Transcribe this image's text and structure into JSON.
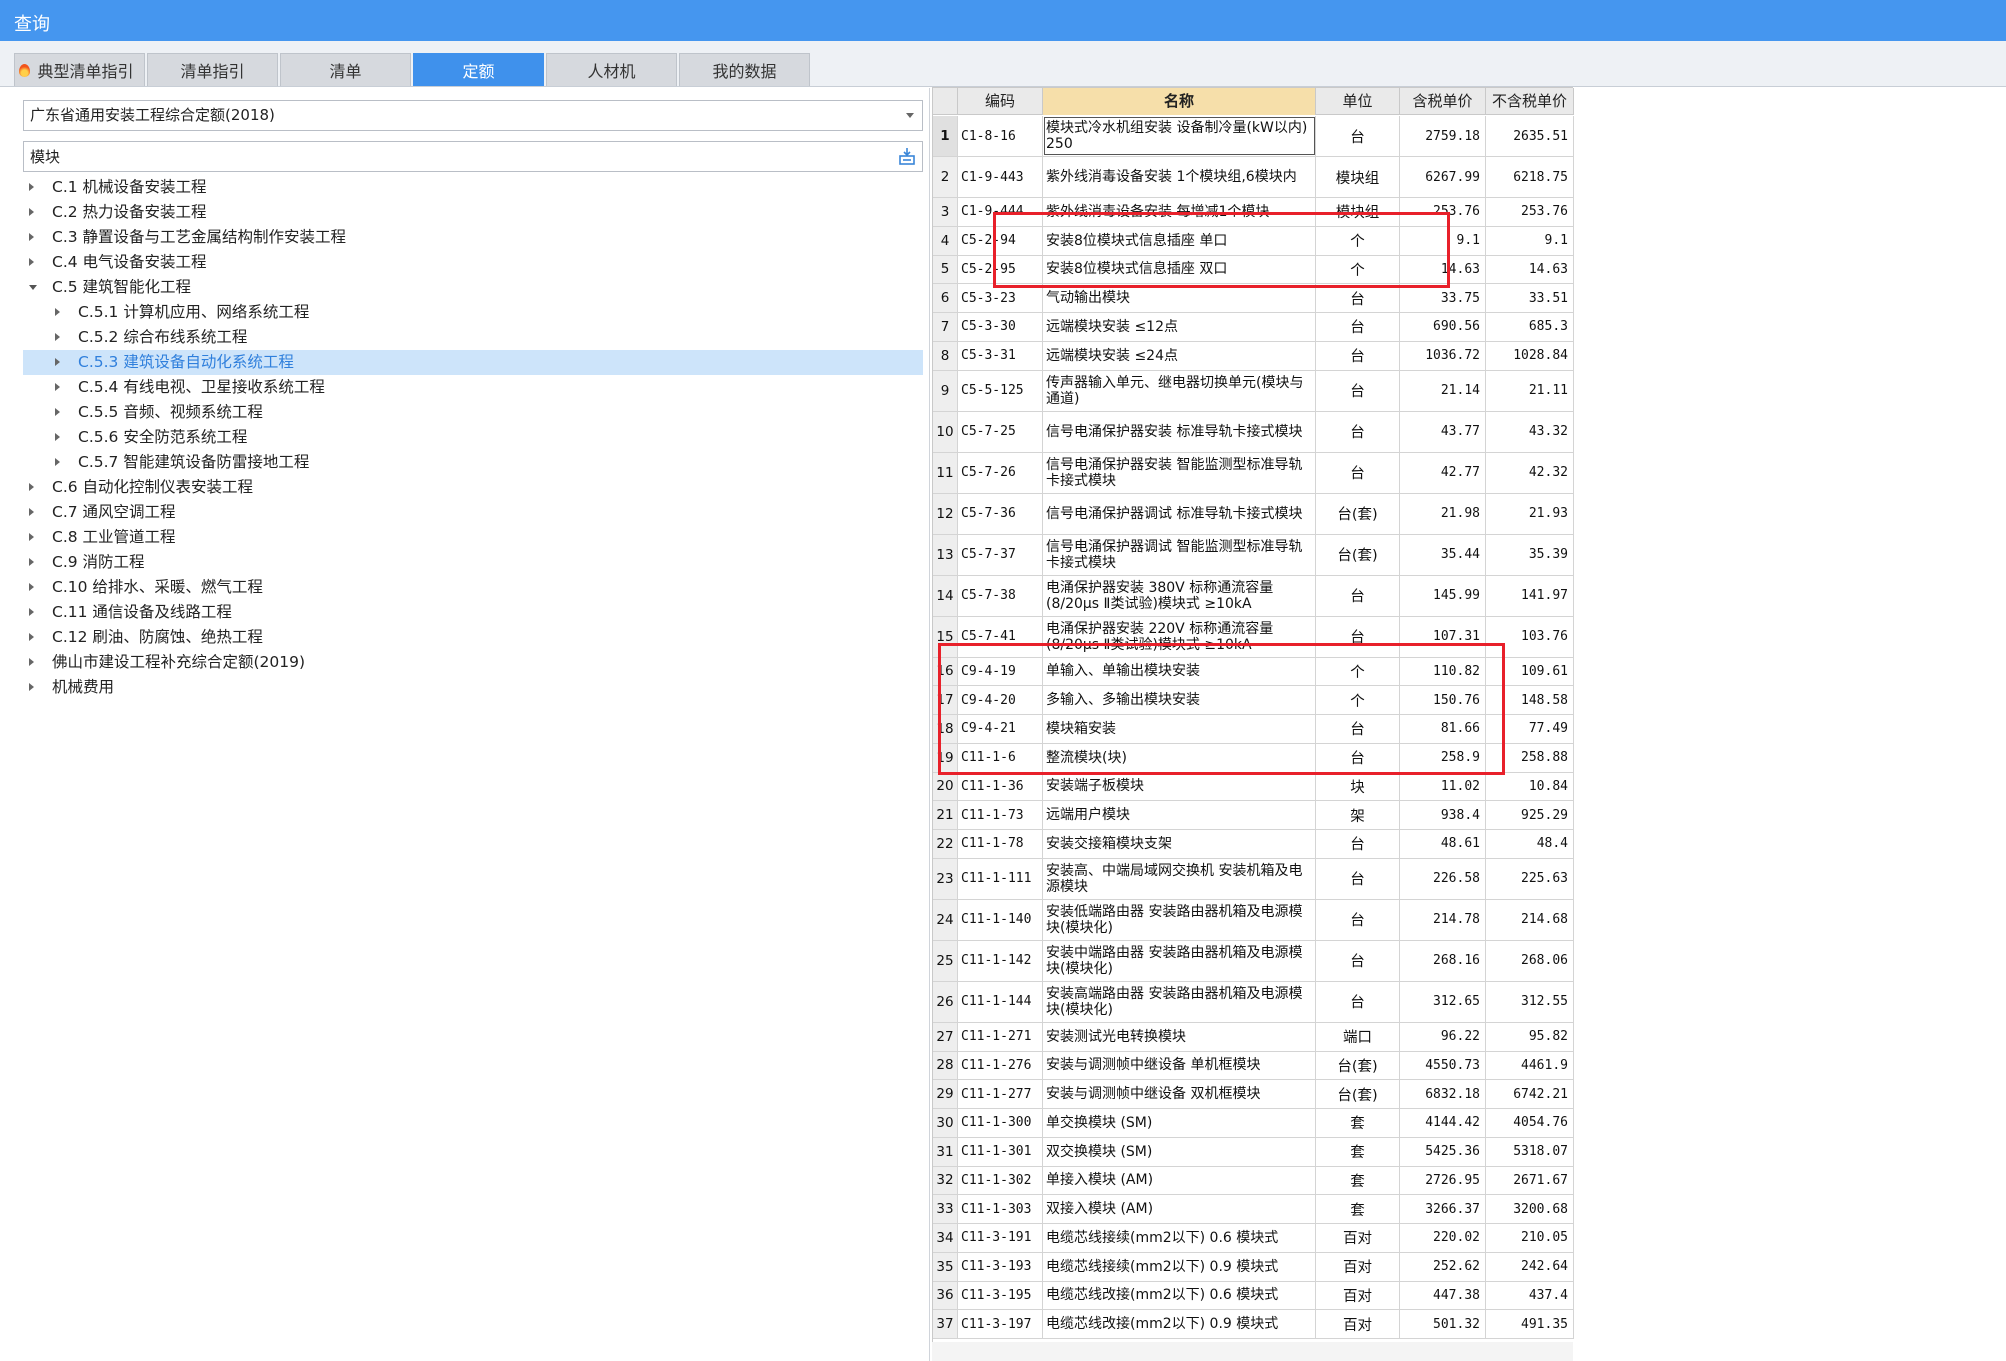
{
  "window": {
    "title": "查询"
  },
  "tabs": [
    {
      "label": "典型清单指引"
    },
    {
      "label": "清单指引"
    },
    {
      "label": "清单"
    },
    {
      "label": "定额",
      "active": true
    },
    {
      "label": "人材机"
    },
    {
      "label": "我的数据"
    }
  ],
  "library": {
    "selected": "广东省通用安装工程综合定额(2018)"
  },
  "search": {
    "value": "模块"
  },
  "tree": [
    {
      "label": "C.1 机械设备安装工程",
      "level": 0,
      "expanded": false
    },
    {
      "label": "C.2 热力设备安装工程",
      "level": 0,
      "expanded": false
    },
    {
      "label": "C.3 静置设备与工艺金属结构制作安装工程",
      "level": 0,
      "expanded": false
    },
    {
      "label": "C.4 电气设备安装工程",
      "level": 0,
      "expanded": false
    },
    {
      "label": "C.5 建筑智能化工程",
      "level": 0,
      "expanded": true
    },
    {
      "label": "C.5.1 计算机应用、网络系统工程",
      "level": 1,
      "expanded": false
    },
    {
      "label": "C.5.2 综合布线系统工程",
      "level": 1,
      "expanded": false
    },
    {
      "label": "C.5.3 建筑设备自动化系统工程",
      "level": 1,
      "expanded": false,
      "selected": true
    },
    {
      "label": "C.5.4 有线电视、卫星接收系统工程",
      "level": 1,
      "expanded": false
    },
    {
      "label": "C.5.5 音频、视频系统工程",
      "level": 1,
      "expanded": false
    },
    {
      "label": "C.5.6 安全防范系统工程",
      "level": 1,
      "expanded": false
    },
    {
      "label": "C.5.7 智能建筑设备防雷接地工程",
      "level": 1,
      "expanded": false
    },
    {
      "label": "C.6 自动化控制仪表安装工程",
      "level": 0,
      "expanded": false
    },
    {
      "label": "C.7 通风空调工程",
      "level": 0,
      "expanded": false
    },
    {
      "label": "C.8 工业管道工程",
      "level": 0,
      "expanded": false
    },
    {
      "label": "C.9 消防工程",
      "level": 0,
      "expanded": false
    },
    {
      "label": "C.10 给排水、采暖、燃气工程",
      "level": 0,
      "expanded": false
    },
    {
      "label": "C.11 通信设备及线路工程",
      "level": 0,
      "expanded": false
    },
    {
      "label": "C.12 刷油、防腐蚀、绝热工程",
      "level": 0,
      "expanded": false
    },
    {
      "label": "佛山市建设工程补充综合定额(2019)",
      "level": 0,
      "expanded": false
    },
    {
      "label": "机械费用",
      "level": 0,
      "expanded": false
    }
  ],
  "grid": {
    "headers": [
      "编码",
      "名称",
      "单位",
      "含税单价",
      "不含税单价"
    ],
    "rows": [
      {
        "num": "1",
        "code": "C1-8-16",
        "name": "模块式冷水机组安装 设备制冷量(kW以内) 250",
        "unit": "台",
        "tax": "2759.18",
        "notax": "2635.51"
      },
      {
        "num": "2",
        "code": "C1-9-443",
        "name": "紫外线消毒设备安装 1个模块组,6模块内",
        "unit": "模块组",
        "tax": "6267.99",
        "notax": "6218.75"
      },
      {
        "num": "3",
        "code": "C1-9-444",
        "name": "紫外线消毒设备安装 每增减1个模块",
        "unit": "模块组",
        "tax": "253.76",
        "notax": "253.76"
      },
      {
        "num": "4",
        "code": "C5-2-94",
        "name": "安装8位模块式信息插座 单口",
        "unit": "个",
        "tax": "9.1",
        "notax": "9.1"
      },
      {
        "num": "5",
        "code": "C5-2-95",
        "name": "安装8位模块式信息插座 双口",
        "unit": "个",
        "tax": "14.63",
        "notax": "14.63"
      },
      {
        "num": "6",
        "code": "C5-3-23",
        "name": "气动输出模块",
        "unit": "台",
        "tax": "33.75",
        "notax": "33.51"
      },
      {
        "num": "7",
        "code": "C5-3-30",
        "name": "远端模块安装 ≤12点",
        "unit": "台",
        "tax": "690.56",
        "notax": "685.3"
      },
      {
        "num": "8",
        "code": "C5-3-31",
        "name": "远端模块安装 ≤24点",
        "unit": "台",
        "tax": "1036.72",
        "notax": "1028.84"
      },
      {
        "num": "9",
        "code": "C5-5-125",
        "name": "传声器输入单元、继电器切换单元(模块与通道)",
        "unit": "台",
        "tax": "21.14",
        "notax": "21.11"
      },
      {
        "num": "10",
        "code": "C5-7-25",
        "name": "信号电涌保护器安装 标准导轨卡接式模块",
        "unit": "台",
        "tax": "43.77",
        "notax": "43.32"
      },
      {
        "num": "11",
        "code": "C5-7-26",
        "name": "信号电涌保护器安装 智能监测型标准导轨卡接式模块",
        "unit": "台",
        "tax": "42.77",
        "notax": "42.32"
      },
      {
        "num": "12",
        "code": "C5-7-36",
        "name": "信号电涌保护器调试 标准导轨卡接式模块",
        "unit": "台(套)",
        "tax": "21.98",
        "notax": "21.93"
      },
      {
        "num": "13",
        "code": "C5-7-37",
        "name": "信号电涌保护器调试 智能监测型标准导轨卡接式模块",
        "unit": "台(套)",
        "tax": "35.44",
        "notax": "35.39"
      },
      {
        "num": "14",
        "code": "C5-7-38",
        "name": "电涌保护器安装 380V 标称通流容量(8/20μs Ⅱ类试验)模块式 ≥10kA",
        "unit": "台",
        "tax": "145.99",
        "notax": "141.97"
      },
      {
        "num": "15",
        "code": "C5-7-41",
        "name": "电涌保护器安装 220V 标称通流容量(8/20μs Ⅱ类试验)模块式 ≥10kA",
        "unit": "台",
        "tax": "107.31",
        "notax": "103.76"
      },
      {
        "num": "16",
        "code": "C9-4-19",
        "name": "单输入、单输出模块安装",
        "unit": "个",
        "tax": "110.82",
        "notax": "109.61"
      },
      {
        "num": "17",
        "code": "C9-4-20",
        "name": "多输入、多输出模块安装",
        "unit": "个",
        "tax": "150.76",
        "notax": "148.58"
      },
      {
        "num": "18",
        "code": "C9-4-21",
        "name": "模块箱安装",
        "unit": "台",
        "tax": "81.66",
        "notax": "77.49"
      },
      {
        "num": "19",
        "code": "C11-1-6",
        "name": "整流模块(块)",
        "unit": "台",
        "tax": "258.9",
        "notax": "258.88"
      },
      {
        "num": "20",
        "code": "C11-1-36",
        "name": "安装端子板模块",
        "unit": "块",
        "tax": "11.02",
        "notax": "10.84"
      },
      {
        "num": "21",
        "code": "C11-1-73",
        "name": "远端用户模块",
        "unit": "架",
        "tax": "938.4",
        "notax": "925.29"
      },
      {
        "num": "22",
        "code": "C11-1-78",
        "name": "安装交接箱模块支架",
        "unit": "台",
        "tax": "48.61",
        "notax": "48.4"
      },
      {
        "num": "23",
        "code": "C11-1-111",
        "name": "安装高、中端局域网交换机 安装机箱及电源模块",
        "unit": "台",
        "tax": "226.58",
        "notax": "225.63"
      },
      {
        "num": "24",
        "code": "C11-1-140",
        "name": "安装低端路由器 安装路由器机箱及电源模块(模块化)",
        "unit": "台",
        "tax": "214.78",
        "notax": "214.68"
      },
      {
        "num": "25",
        "code": "C11-1-142",
        "name": "安装中端路由器 安装路由器机箱及电源模块(模块化)",
        "unit": "台",
        "tax": "268.16",
        "notax": "268.06"
      },
      {
        "num": "26",
        "code": "C11-1-144",
        "name": "安装高端路由器 安装路由器机箱及电源模块(模块化)",
        "unit": "台",
        "tax": "312.65",
        "notax": "312.55"
      },
      {
        "num": "27",
        "code": "C11-1-271",
        "name": "安装测试光电转换模块",
        "unit": "端口",
        "tax": "96.22",
        "notax": "95.82"
      },
      {
        "num": "28",
        "code": "C11-1-276",
        "name": "安装与调测帧中继设备 单机框模块",
        "unit": "台(套)",
        "tax": "4550.73",
        "notax": "4461.9"
      },
      {
        "num": "29",
        "code": "C11-1-277",
        "name": "安装与调测帧中继设备 双机框模块",
        "unit": "台(套)",
        "tax": "6832.18",
        "notax": "6742.21"
      },
      {
        "num": "30",
        "code": "C11-1-300",
        "name": "单交换模块 (SM)",
        "unit": "套",
        "tax": "4144.42",
        "notax": "4054.76"
      },
      {
        "num": "31",
        "code": "C11-1-301",
        "name": "双交换模块 (SM)",
        "unit": "套",
        "tax": "5425.36",
        "notax": "5318.07"
      },
      {
        "num": "32",
        "code": "C11-1-302",
        "name": "单接入模块 (AM)",
        "unit": "套",
        "tax": "2726.95",
        "notax": "2671.67"
      },
      {
        "num": "33",
        "code": "C11-1-303",
        "name": "双接入模块 (AM)",
        "unit": "套",
        "tax": "3266.37",
        "notax": "3200.68"
      },
      {
        "num": "34",
        "code": "C11-3-191",
        "name": "电缆芯线接续(mm2以下) 0.6 模块式",
        "unit": "百对",
        "tax": "220.02",
        "notax": "210.05"
      },
      {
        "num": "35",
        "code": "C11-3-193",
        "name": "电缆芯线接续(mm2以下) 0.9 模块式",
        "unit": "百对",
        "tax": "252.62",
        "notax": "242.64"
      },
      {
        "num": "36",
        "code": "C11-3-195",
        "name": "电缆芯线改接(mm2以下) 0.6 模块式",
        "unit": "百对",
        "tax": "447.38",
        "notax": "437.4"
      },
      {
        "num": "37",
        "code": "C11-3-197",
        "name": "电缆芯线改接(mm2以下) 0.9 模块式",
        "unit": "百对",
        "tax": "501.32",
        "notax": "491.35"
      }
    ]
  },
  "colors": {
    "titlebar": "#4596ef",
    "active_tab": "#3f91ec",
    "highlight_box": "#e8202a",
    "selected_node_bg": "#cde4fa"
  }
}
